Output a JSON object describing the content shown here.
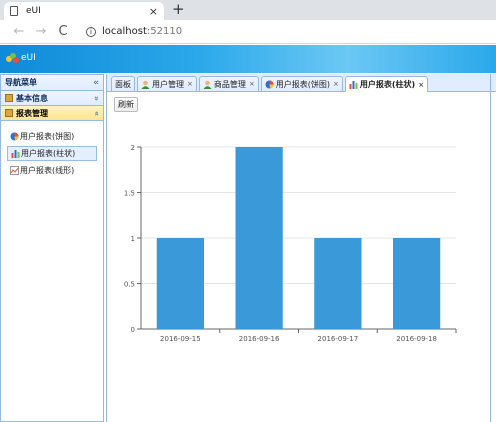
{
  "browser": {
    "tab_title": "eUI",
    "tab_close": "×",
    "new_tab": "+",
    "back": "←",
    "forward": "→",
    "reload": "C",
    "info": "i",
    "url_host": "localhost",
    "url_port": ":52110"
  },
  "app": {
    "logo_text": "eUI"
  },
  "nav": {
    "title": "导航菜单",
    "collapse_glyph": "«",
    "sections": [
      {
        "label": "基本信息",
        "chevron": "»",
        "active": false
      },
      {
        "label": "报表管理",
        "chevron": "»",
        "active": true
      }
    ],
    "tree_items": [
      {
        "label": "用户报表(饼图)",
        "icon": "pie-chart-icon",
        "selected": false
      },
      {
        "label": "用户报表(柱状)",
        "icon": "bar-chart-icon",
        "selected": true
      },
      {
        "label": "用户报表(线形)",
        "icon": "line-chart-icon",
        "selected": false
      }
    ]
  },
  "tabs": [
    {
      "label": "面板",
      "icon": "",
      "closable": false,
      "active": false
    },
    {
      "label": "用户管理",
      "icon": "user-icon",
      "closable": true,
      "active": false
    },
    {
      "label": "商品管理",
      "icon": "user-icon",
      "closable": true,
      "active": false
    },
    {
      "label": "用户报表(饼图)",
      "icon": "pie-chart-icon",
      "closable": true,
      "active": false
    },
    {
      "label": "用户报表(柱状)",
      "icon": "bar-chart-icon",
      "closable": true,
      "active": true
    }
  ],
  "tab_close_glyph": "×",
  "toolbar": {
    "refresh_label": "刷新"
  },
  "colors": {
    "bar": "#3a9ad9",
    "accent": "#2aa8ea",
    "border": "#95b8e7"
  },
  "chart_data": {
    "type": "bar",
    "categories": [
      "2016-09-15",
      "2016-09-16",
      "2016-09-17",
      "2016-09-18"
    ],
    "values": [
      1,
      2,
      1,
      1
    ],
    "title": "",
    "xlabel": "",
    "ylabel": "",
    "ylim": [
      0,
      2
    ],
    "yticks": [
      "0",
      "0.5",
      "1",
      "1.5",
      "2"
    ],
    "grid": true,
    "legend": "none"
  }
}
